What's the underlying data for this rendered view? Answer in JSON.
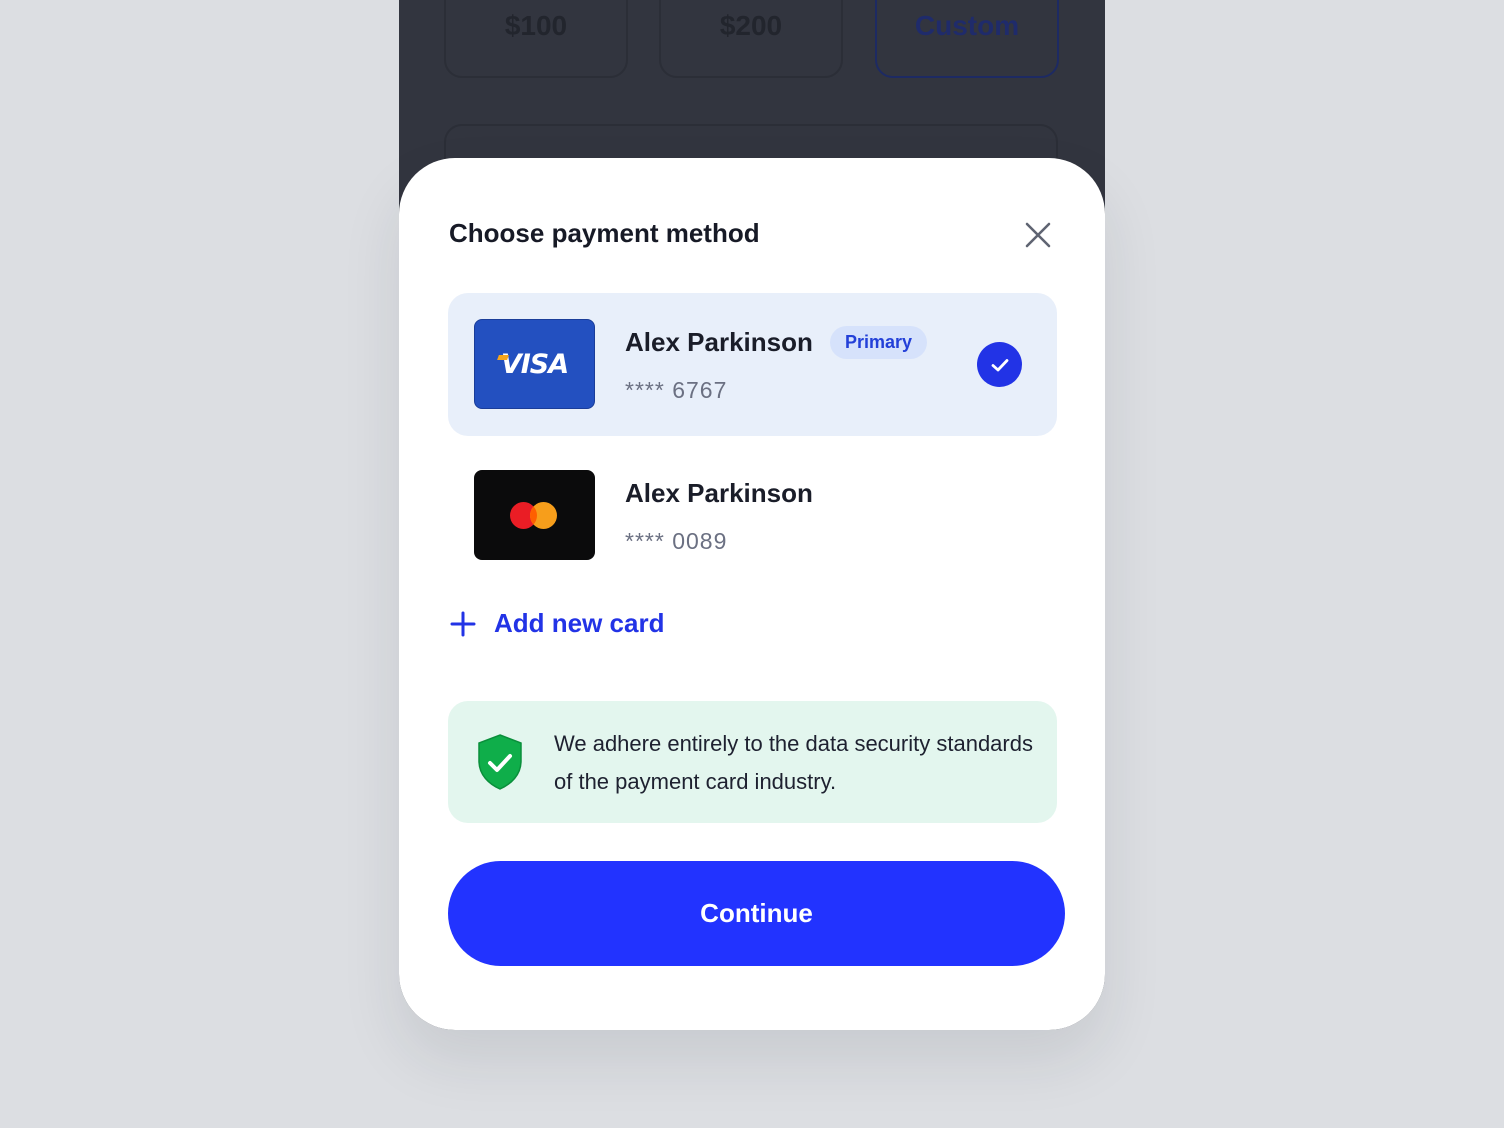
{
  "background": {
    "amount_options": [
      "$100",
      "$200",
      "Custom"
    ]
  },
  "sheet": {
    "title": "Choose payment method",
    "close_icon": "close-icon",
    "cards": [
      {
        "brand": "VISA",
        "holder": "Alex Parkinson",
        "masked_number": "**** 6767",
        "badge": "Primary",
        "selected": true
      },
      {
        "brand": "mastercard",
        "holder": "Alex Parkinson",
        "masked_number": "**** 0089",
        "selected": false
      }
    ],
    "add_card_label": "Add new card",
    "security_notice": "We adhere entirely to the data security standards of the payment card industry.",
    "continue_label": "Continue"
  },
  "colors": {
    "accent": "#2233ff",
    "selected_row_bg": "#e8effa",
    "notice_bg": "#e3f6ee",
    "shield_green": "#0fae4a"
  }
}
